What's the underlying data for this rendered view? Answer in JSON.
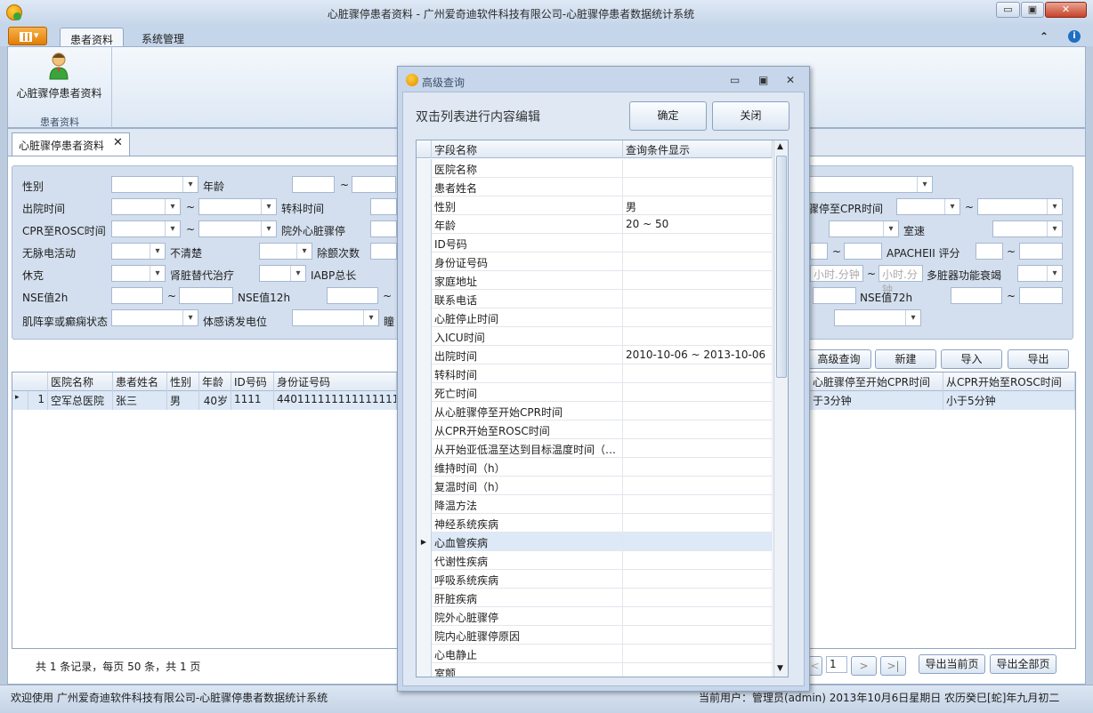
{
  "window": {
    "title": "心脏骤停患者资料 - 广州爱奇迪软件科技有限公司-心脏骤停患者数据统计系统",
    "min": "▭",
    "max": "▣",
    "close": "✕"
  },
  "ribbon": {
    "tabs": [
      "患者资料",
      "系统管理"
    ],
    "button_label": "心脏骤停患者资料",
    "group_caption": "患者资料",
    "collapse_icon": "⌃",
    "help_icon": "i"
  },
  "document_tab": {
    "label": "心脏骤停患者资料",
    "close": "✕"
  },
  "search_form": {
    "gender": "性别",
    "age": "年龄",
    "tilde": "~",
    "discharge_time": "出院时间",
    "transfer_time": "转科时间",
    "cpr_to_rosc": "CPR至ROSC时间",
    "out_hospital_arrest": "院外心脏骤停",
    "pulseless": "无脉电活动",
    "unclear": "不清楚",
    "defib_count": "除颤次数",
    "shock": "休克",
    "renal_replacement": "肾脏替代治疗",
    "iabp": "IABP总长",
    "nse2h": "NSE值2h",
    "nse12h": "NSE值12h",
    "myoclonus": "肌阵挛或癫痫状态",
    "ssep": "体感诱发电位",
    "pupil": "瞳",
    "arrest_to_cpr": "骤停至CPR时间",
    "ventricular": "室速",
    "apache": "APACHEII 评分",
    "mods": "多脏器功能衰竭",
    "nse72h": "NSE值72h",
    "time_placeholder": "小时.分钟"
  },
  "actions": {
    "advanced": "高级查询",
    "new": "新建",
    "import": "导入",
    "export": "导出"
  },
  "grid": {
    "headers": [
      "医院名称",
      "患者姓名",
      "性别",
      "年龄",
      "ID号码",
      "身份证号码"
    ],
    "headers_right": [
      "心脏骤停至开始CPR时间",
      "从CPR开始至ROSC时间"
    ],
    "row": {
      "indicator": "▸",
      "num": "1",
      "cells": [
        "空军总医院",
        "张三",
        "男",
        "40岁",
        "1111",
        "440111111111111111"
      ],
      "cells_right": [
        "于3分钟",
        "小于5分钟"
      ]
    }
  },
  "footer": {
    "summary": "共 1 条记录，每页 50 条，共 1 页",
    "page": "1",
    "next": ">",
    "last": ">|",
    "prev": "<",
    "export_current": "导出当前页",
    "export_all": "导出全部页"
  },
  "status": {
    "welcome": "欢迎使用 广州爱奇迪软件科技有限公司-心脏骤停患者数据统计系统",
    "right": "当前用户：管理员(admin)   2013年10月6日星期日 农历癸巳[蛇]年九月初二"
  },
  "dialog": {
    "title": "高级查询",
    "hint": "双击列表进行内容编辑",
    "ok": "确定",
    "cancel": "关闭",
    "col_field": "字段名称",
    "col_condition": "查询条件显示",
    "rows": [
      {
        "field": "医院名称",
        "cond": ""
      },
      {
        "field": "患者姓名",
        "cond": ""
      },
      {
        "field": "性别",
        "cond": "男"
      },
      {
        "field": "年龄",
        "cond": "20 ~ 50"
      },
      {
        "field": "ID号码",
        "cond": ""
      },
      {
        "field": "身份证号码",
        "cond": ""
      },
      {
        "field": "家庭地址",
        "cond": ""
      },
      {
        "field": "联系电话",
        "cond": ""
      },
      {
        "field": "心脏停止时间",
        "cond": ""
      },
      {
        "field": "入ICU时间",
        "cond": ""
      },
      {
        "field": "出院时间",
        "cond": "2010-10-06 ~ 2013-10-06"
      },
      {
        "field": "转科时间",
        "cond": ""
      },
      {
        "field": "死亡时间",
        "cond": ""
      },
      {
        "field": "从心脏骤停至开始CPR时间",
        "cond": ""
      },
      {
        "field": "从CPR开始至ROSC时间",
        "cond": ""
      },
      {
        "field": "从开始亚低温至达到目标温度时间（…",
        "cond": ""
      },
      {
        "field": "维持时间（h）",
        "cond": ""
      },
      {
        "field": "复温时间（h）",
        "cond": ""
      },
      {
        "field": "降温方法",
        "cond": ""
      },
      {
        "field": "神经系统疾病",
        "cond": ""
      },
      {
        "field": "心血管疾病",
        "cond": "",
        "selected": true
      },
      {
        "field": "代谢性疾病",
        "cond": ""
      },
      {
        "field": "呼吸系统疾病",
        "cond": ""
      },
      {
        "field": "肝脏疾病",
        "cond": ""
      },
      {
        "field": "院外心脏骤停",
        "cond": ""
      },
      {
        "field": "院内心脏骤停原因",
        "cond": ""
      },
      {
        "field": "心电静止",
        "cond": ""
      },
      {
        "field": "室颤",
        "cond": ""
      }
    ]
  }
}
